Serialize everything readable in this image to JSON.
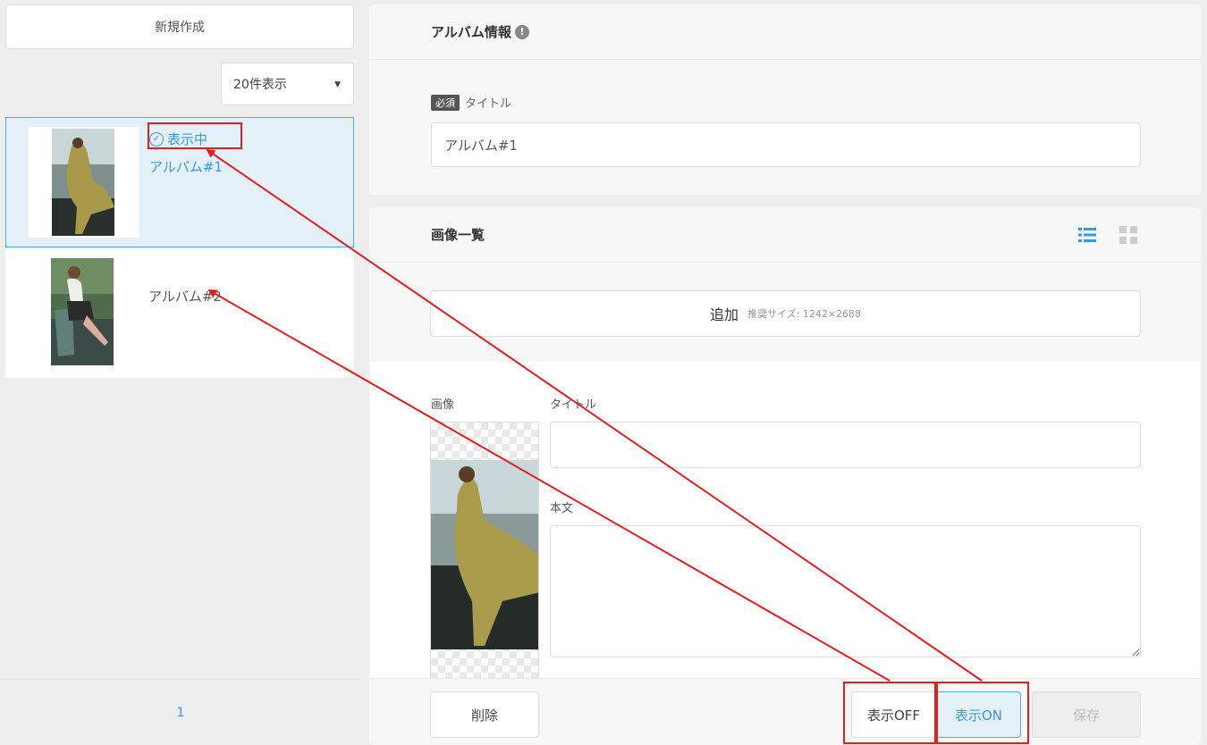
{
  "sidebar": {
    "new_button": "新規作成",
    "per_page": "20件表示",
    "albums": [
      {
        "status": "表示中",
        "title": "アルバム#1"
      },
      {
        "title": "アルバム#2"
      }
    ],
    "pagination": "1"
  },
  "album_info": {
    "header": "アルバム情報",
    "required_badge": "必須",
    "title_label": "タイトル",
    "title_value": "アルバム#1"
  },
  "image_list": {
    "header": "画像一覧",
    "add_label": "追加",
    "add_hint": "推奨サイズ: 1242×2688",
    "image_label": "画像",
    "title_label": "タイトル",
    "body_label": "本文"
  },
  "footer": {
    "delete": "削除",
    "display_off": "表示OFF",
    "display_on": "表示ON",
    "save": "保存"
  },
  "colors": {
    "accent": "#3a9ad9",
    "annotation": "#e02020"
  }
}
